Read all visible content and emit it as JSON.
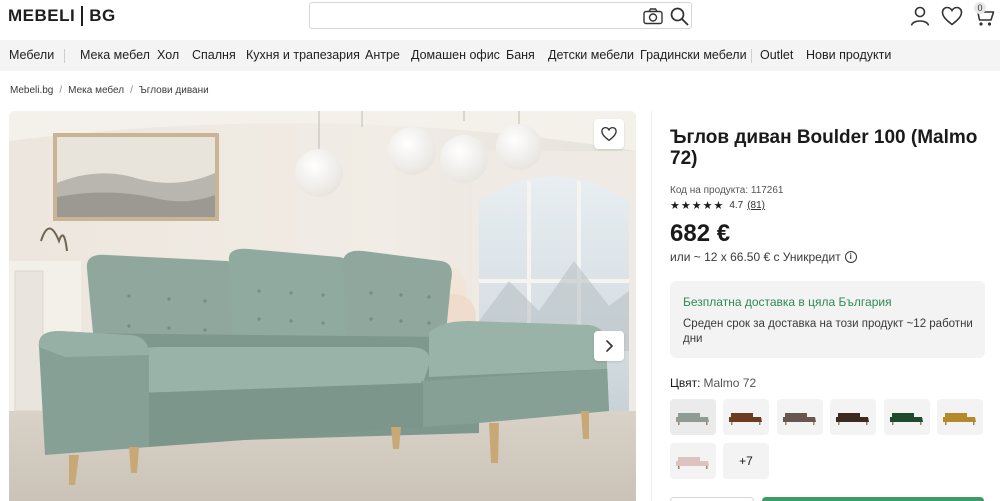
{
  "header": {
    "logo_left": "MEBELI",
    "logo_right": "BG",
    "search_placeholder": "",
    "cart_count": "0"
  },
  "nav": {
    "items": [
      "Мебели",
      "Мека мебел",
      "Хол",
      "Спалня",
      "Кухня и трапезария",
      "Антре",
      "Домашен офис",
      "Баня",
      "Детски мебели",
      "Градински мебели",
      "Outlet",
      "Нови продукти"
    ]
  },
  "breadcrumb": [
    "Mebeli.bg",
    "Мека мебел",
    "Ъглови дивани"
  ],
  "product": {
    "title": "Ъглов диван Boulder 100 (Malmo 72)",
    "sku_label": "Код на продукта: 117261",
    "stars": "★★★★★",
    "rating": "4.7",
    "reviews": "(81)",
    "price": "682 €",
    "installments": "или ~ 12 x 66.50 € с Уникредит",
    "delivery_title": "Безплатна доставка в цяла България",
    "delivery_text": "Среден срок за доставка на този продукт ~12 работни дни",
    "color_label": "Цвят:",
    "color_value": "Malmo 72",
    "more_colors": "+7",
    "swatch_colors": [
      "#8f9c93",
      "#6b3b22",
      "#6a5650",
      "#3b2a22",
      "#1f4a2e",
      "#b48a2a",
      "#dcc3bf"
    ]
  }
}
